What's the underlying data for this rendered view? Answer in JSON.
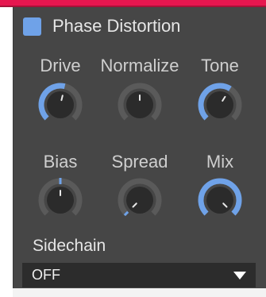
{
  "plugin": {
    "title": "Phase Distortion",
    "enabled": true,
    "accent_color": "#6fa2e8"
  },
  "knobs": [
    {
      "id": "drive",
      "label": "Drive",
      "value": 0.55
    },
    {
      "id": "normalize",
      "label": "Normalize",
      "value": 0.5
    },
    {
      "id": "tone",
      "label": "Tone",
      "value": 0.62
    },
    {
      "id": "bias",
      "label": "Bias",
      "value": 0.5
    },
    {
      "id": "spread",
      "label": "Spread",
      "value": 0.0
    },
    {
      "id": "mix",
      "label": "Mix",
      "value": 1.0
    }
  ],
  "sidechain": {
    "label": "Sidechain",
    "selected": "OFF"
  }
}
